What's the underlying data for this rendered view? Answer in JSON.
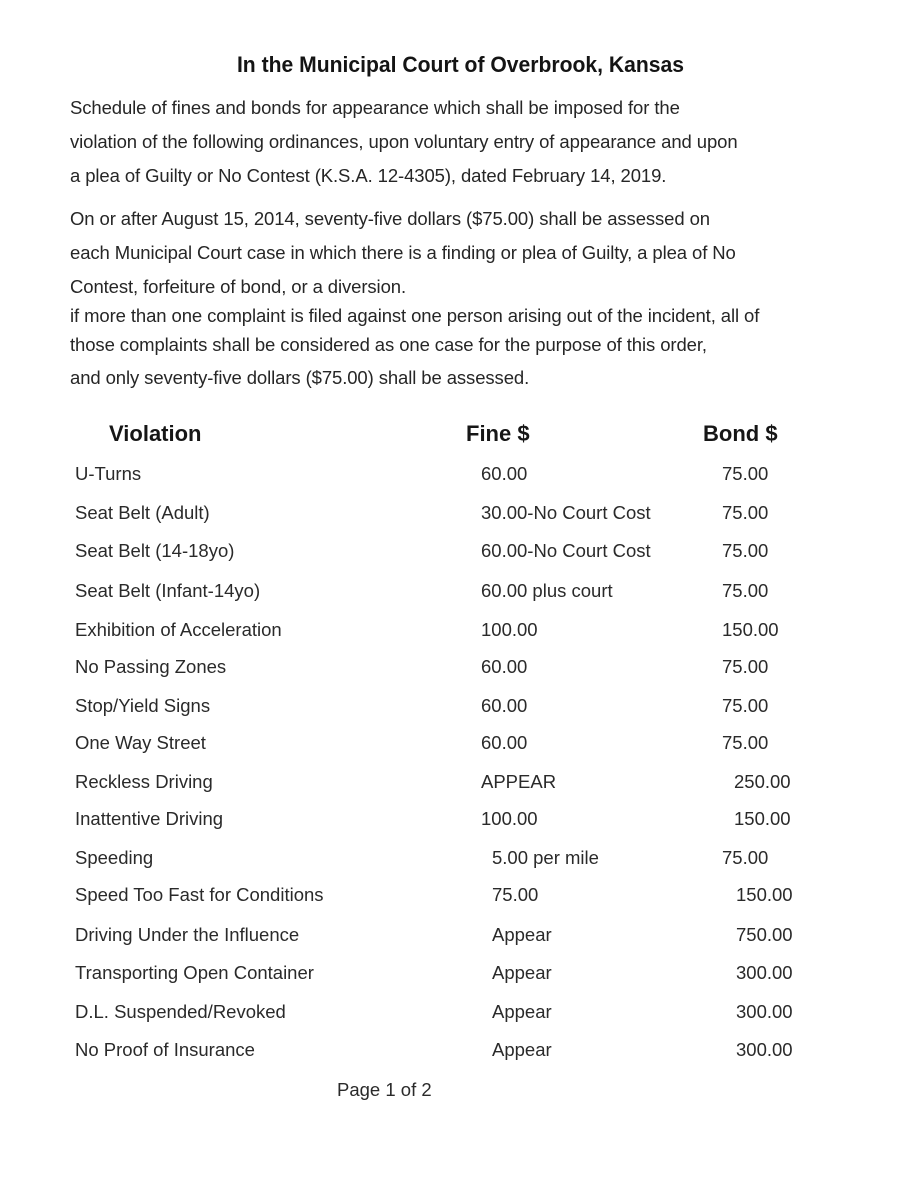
{
  "document": {
    "title": "In the Municipal Court of Overbrook, Kansas",
    "intro_lines": [
      "Schedule of fines and bonds for appearance which shall be imposed for the",
      "violation of the following ordinances, upon voluntary entry of appearance and upon",
      "a plea of Guilty or No Contest (K.S.A. 12-4305), dated February 14, 2019."
    ],
    "assessment_lines": [
      "On or after August 15, 2014, seventy-five dollars ($75.00) shall be assessed on",
      "each Municipal Court case in which there is a finding or plea of Guilty, a plea of No",
      "Contest, forfeiture of bond, or a diversion.",
      "if more than one complaint is filed against one person arising out of the incident, all of",
      "those complaints shall be considered as one case for the purpose of this order,",
      "and only seventy-five dollars ($75.00) shall be assessed."
    ],
    "table": {
      "headers": {
        "violation": "Violation",
        "fine": "Fine $",
        "bond": "Bond $"
      },
      "rows": [
        {
          "violation": "U-Turns",
          "fine": "60.00",
          "bond": "75.00"
        },
        {
          "violation": "Seat Belt (Adult)",
          "fine": "30.00-No Court Cost",
          "bond": "75.00"
        },
        {
          "violation": "Seat Belt (14-18yo)",
          "fine": "60.00-No Court Cost",
          "bond": "75.00"
        },
        {
          "violation": "Seat Belt (Infant-14yo)",
          "fine": "60.00 plus court",
          "bond": "75.00"
        },
        {
          "violation": "Exhibition of Acceleration",
          "fine": "100.00",
          "bond": "150.00"
        },
        {
          "violation": "No Passing Zones",
          "fine": "60.00",
          "bond": "75.00"
        },
        {
          "violation": "Stop/Yield Signs",
          "fine": "60.00",
          "bond": "75.00"
        },
        {
          "violation": "One Way Street",
          "fine": "60.00",
          "bond": "75.00"
        },
        {
          "violation": "Reckless Driving",
          "fine": "APPEAR",
          "bond": "250.00"
        },
        {
          "violation": "Inattentive Driving",
          "fine": "100.00",
          "bond": "150.00"
        },
        {
          "violation": "Speeding",
          "fine": "5.00 per mile",
          "bond": "75.00"
        },
        {
          "violation": "Speed Too Fast for Conditions",
          "fine": "75.00",
          "bond": "150.00"
        },
        {
          "violation": "Driving Under the Influence",
          "fine": "Appear",
          "bond": "750.00"
        },
        {
          "violation": "Transporting Open Container",
          "fine": "Appear",
          "bond": "300.00"
        },
        {
          "violation": "D.L. Suspended/Revoked",
          "fine": "Appear",
          "bond": "300.00"
        },
        {
          "violation": "No Proof of Insurance",
          "fine": "Appear",
          "bond": "300.00"
        }
      ]
    },
    "page_indicator": "Page 1 of 2"
  }
}
